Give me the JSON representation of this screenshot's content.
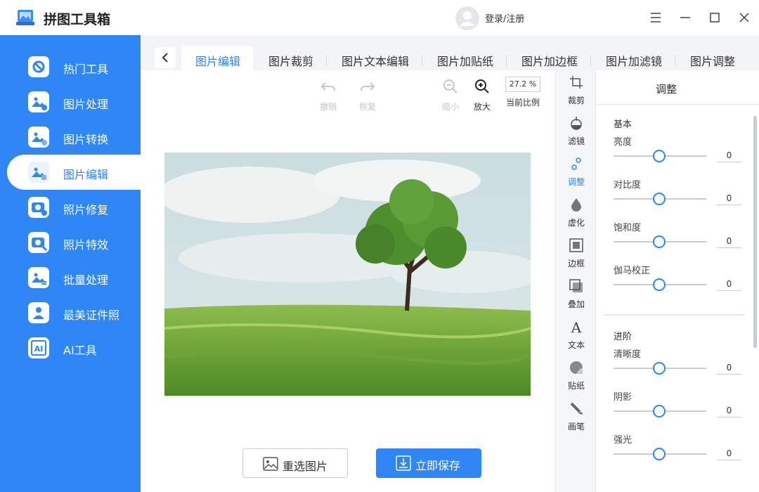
{
  "app": {
    "title": "拼图工具箱",
    "login": "登录/注册",
    "accent": "#2f86f6"
  },
  "sidebar": {
    "items": [
      {
        "label": "热门工具",
        "icon": "hot-tools-icon"
      },
      {
        "label": "图片处理",
        "icon": "image-process-icon"
      },
      {
        "label": "图片转换",
        "icon": "image-convert-icon"
      },
      {
        "label": "图片编辑",
        "icon": "image-edit-icon"
      },
      {
        "label": "照片修复",
        "icon": "photo-repair-icon"
      },
      {
        "label": "照片特效",
        "icon": "photo-effects-icon"
      },
      {
        "label": "批量处理",
        "icon": "batch-process-icon"
      },
      {
        "label": "最美证件照",
        "icon": "id-photo-icon"
      },
      {
        "label": "AI工具",
        "icon": "ai-tools-icon"
      }
    ],
    "active": "图片编辑"
  },
  "tabs": [
    "图片编辑",
    "图片裁剪",
    "图片文本编辑",
    "图片加贴纸",
    "图片加边框",
    "图片加滤镜",
    "图片调整"
  ],
  "toolbar": {
    "undo": "撤销",
    "redo": "恢复",
    "zoom_out": "缩小",
    "zoom_in": "放大",
    "zoom_value": "27.2 %",
    "zoom_label": "当前比例"
  },
  "buttons": {
    "reselect": "重选图片",
    "save": "立即保存"
  },
  "rail": [
    "裁剪",
    "滤镜",
    "调整",
    "虚化",
    "边框",
    "叠加",
    "文本",
    "贴纸",
    "画笔"
  ],
  "rail_active": "调整",
  "panel": {
    "title": "调整",
    "basic": {
      "title": "基本",
      "items": [
        {
          "label": "亮度",
          "value": "0"
        },
        {
          "label": "对比度",
          "value": "0"
        },
        {
          "label": "饱和度",
          "value": "0"
        },
        {
          "label": "伽马校正",
          "value": "0"
        }
      ]
    },
    "advanced": {
      "title": "进阶",
      "items": [
        {
          "label": "清晰度",
          "value": "0"
        },
        {
          "label": "阴影",
          "value": "0"
        },
        {
          "label": "强光",
          "value": "0"
        }
      ]
    }
  }
}
